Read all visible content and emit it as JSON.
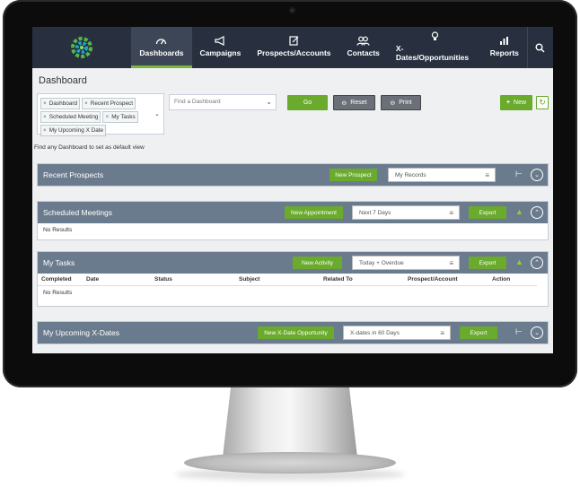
{
  "nav": {
    "items": [
      {
        "label": "Dashboards",
        "icon": "gauge-icon",
        "active": true
      },
      {
        "label": "Campaigns",
        "icon": "megaphone-icon"
      },
      {
        "label": "Prospects/Accounts",
        "icon": "edit-icon"
      },
      {
        "label": "Contacts",
        "icon": "contacts-icon"
      },
      {
        "label": "X-Dates/Opportunities",
        "icon": "lightbulb-icon"
      },
      {
        "label": "Reports",
        "icon": "bar-chart-icon"
      }
    ],
    "search_icon": "search-icon"
  },
  "page": {
    "title": "Dashboard",
    "hint": "Find any Dashboard to set as default view"
  },
  "filters": {
    "tags": [
      "Dashboard",
      "Recent Prospect",
      "Scheduled Meeting",
      "My Tasks",
      "My Upcoming X Date"
    ],
    "find_placeholder": "Find a Dashboard",
    "go_label": "Go",
    "reset_label": "Reset",
    "print_label": "Print",
    "new_label": "New"
  },
  "panels": {
    "prospects": {
      "title": "Recent Prospects",
      "button": "New Prospect",
      "select": "My Records"
    },
    "meetings": {
      "title": "Scheduled Meetings",
      "button": "New Appointment",
      "select": "Next 7 Days",
      "export": "Export",
      "empty": "No Results"
    },
    "tasks": {
      "title": "My Tasks",
      "button": "New Activity",
      "select": "Today + Overdue",
      "export": "Export",
      "empty": "No Results",
      "columns": [
        "Completed",
        "Date",
        "Status",
        "Subject",
        "Related To",
        "Prospect/Account",
        "Action"
      ]
    },
    "xdates": {
      "title": "My Upcoming X-Dates",
      "button": "New X-Date Opportunity",
      "select": "X-dates in 60 Days",
      "export": "Export"
    }
  },
  "colors": {
    "nav": "#283040",
    "accent": "#6aaa2d",
    "panel_header": "#6b7b8e"
  }
}
